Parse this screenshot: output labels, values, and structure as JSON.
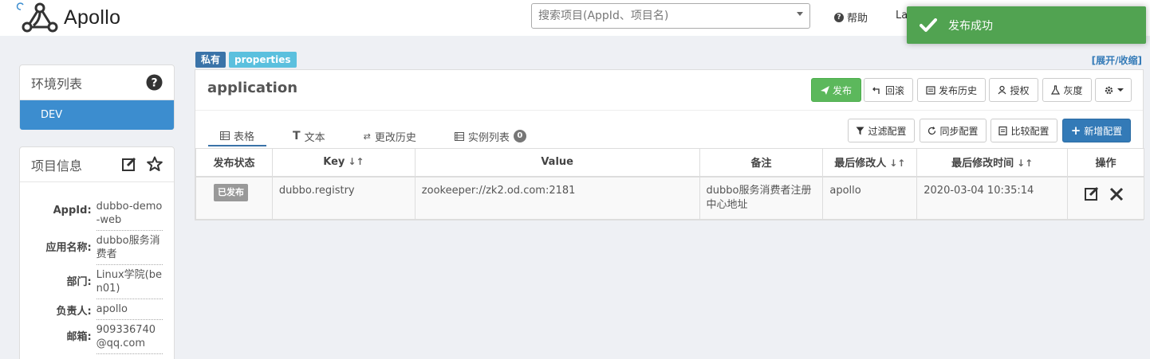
{
  "header": {
    "logo_text": "Apollo",
    "search_placeholder": "搜索项目(AppId、项目名)",
    "help_label": "帮助",
    "lang_label": "La"
  },
  "toast": {
    "message": "发布成功"
  },
  "sidebar": {
    "env_title": "环境列表",
    "env_items": [
      "DEV"
    ],
    "info_title": "项目信息",
    "info_rows": [
      {
        "label": "AppId:",
        "value": "dubbo-demo-web"
      },
      {
        "label": "应用名称:",
        "value": "dubbo服务消费者"
      },
      {
        "label": "部门:",
        "value": "Linux学院(ben01)"
      },
      {
        "label": "负责人:",
        "value": "apollo"
      },
      {
        "label": "邮箱:",
        "value": "909336740@qq.com"
      }
    ]
  },
  "namespace": {
    "tag_private": "私有",
    "tag_format": "properties",
    "expand_label": "[展开/收缩]",
    "title": "application",
    "actions": {
      "publish": "发布",
      "rollback": "回滚",
      "history": "发布历史",
      "grant": "授权",
      "gray": "灰度"
    },
    "tabs": {
      "table": "表格",
      "text": "文本",
      "change_history": "更改历史",
      "instances": "实例列表",
      "instances_count": "0"
    },
    "tools": {
      "filter": "过滤配置",
      "sync": "同步配置",
      "compare": "比较配置",
      "add": "新增配置"
    },
    "columns": {
      "status": "发布状态",
      "key": "Key",
      "value": "Value",
      "comment": "备注",
      "modifier": "最后修改人",
      "modified_time": "最后修改时间",
      "ops": "操作"
    },
    "rows": [
      {
        "status": "已发布",
        "key": "dubbo.registry",
        "value": "zookeeper://zk2.od.com:2181",
        "comment": "dubbo服务消费者注册中心地址",
        "modifier": "apollo",
        "modified_time": "2020-03-04 10:35:14"
      }
    ]
  },
  "colors": {
    "primary": "#337ab7",
    "success": "#5cb85c",
    "env_active": "#3c8dcf",
    "toast": "#51a351",
    "tag_private": "#3a73a8",
    "tag_format": "#5bc0de"
  }
}
